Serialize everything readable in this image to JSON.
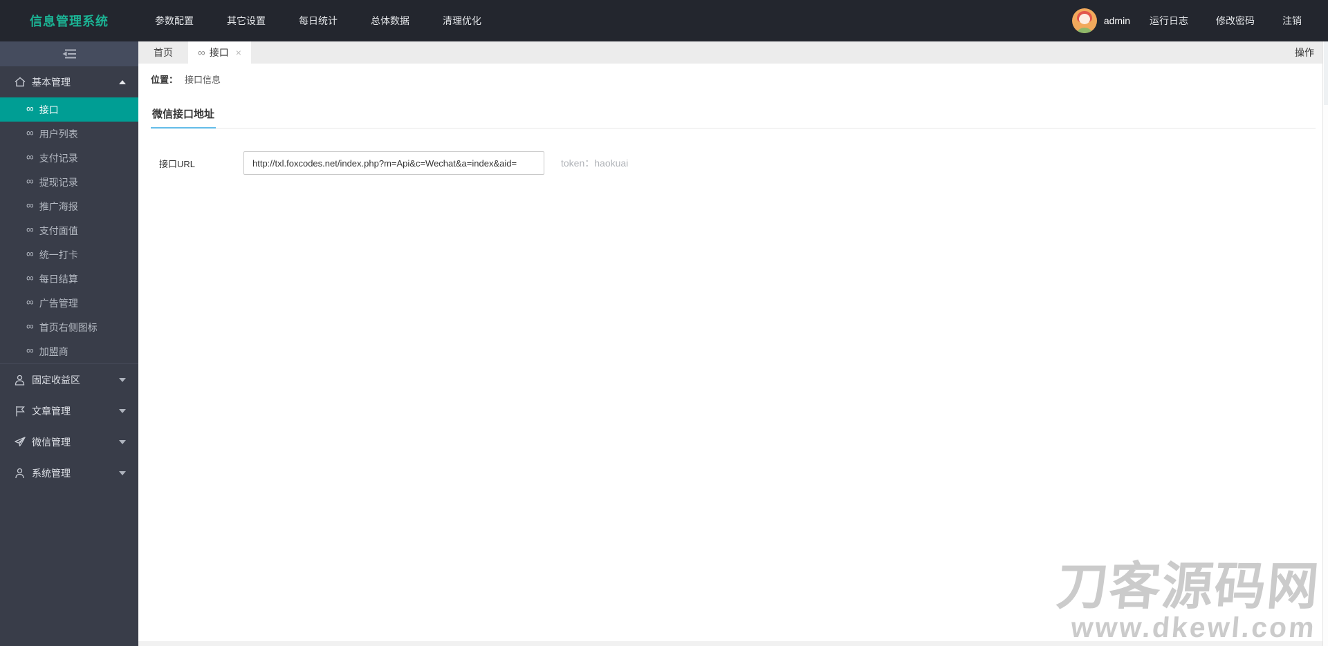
{
  "colors": {
    "navbar_bg": "#23262E",
    "sidebar_bg": "#393D49",
    "active_item_bg": "#009E94",
    "logo_color": "#1bb394",
    "tab_underline": "#63BCE8"
  },
  "navbar": {
    "logo": "信息管理系统",
    "menu": [
      "参数配置",
      "其它设置",
      "每日统计",
      "总体数据",
      "清理优化"
    ],
    "user": {
      "name": "admin",
      "avatar_icon": "user-avatar"
    },
    "right_menu": [
      "运行日志",
      "修改密码",
      "注销"
    ]
  },
  "sidebar": {
    "fold_icon": "collapse-menu-icon",
    "groups": [
      {
        "label": "基本管理",
        "icon": "home-icon",
        "expanded": true,
        "items": [
          {
            "label": "接口",
            "active": true
          },
          {
            "label": "用户列表"
          },
          {
            "label": "支付记录"
          },
          {
            "label": "提现记录"
          },
          {
            "label": "推广海报"
          },
          {
            "label": "支付面值"
          },
          {
            "label": "统一打卡"
          },
          {
            "label": "每日结算"
          },
          {
            "label": "广告管理"
          },
          {
            "label": "首页右侧图标"
          },
          {
            "label": "加盟商"
          }
        ]
      },
      {
        "label": "固定收益区",
        "icon": "person-icon",
        "expanded": false
      },
      {
        "label": "文章管理",
        "icon": "flag-icon",
        "expanded": false
      },
      {
        "label": "微信管理",
        "icon": "paper-plane-icon",
        "expanded": false
      },
      {
        "label": "系统管理",
        "icon": "user-icon",
        "expanded": false
      }
    ],
    "link_glyph": "∞"
  },
  "tabs": {
    "items": [
      {
        "label": "首页",
        "active": false
      },
      {
        "label": "接口",
        "active": true,
        "glyph": "∞",
        "close": "×"
      }
    ],
    "action_label": "操作"
  },
  "breadcrumb": {
    "prefix": "位置：",
    "current": "接口信息"
  },
  "content": {
    "section_title": "微信接口地址",
    "form": {
      "url_label": "接口URL",
      "url_value": "http://txl.foxcodes.net/index.php?m=Api&c=Wechat&a=index&aid=",
      "token_text": "token：haokuai"
    }
  },
  "watermark": {
    "line1": "刀客源码网",
    "line2": "www.dkewl.com"
  }
}
